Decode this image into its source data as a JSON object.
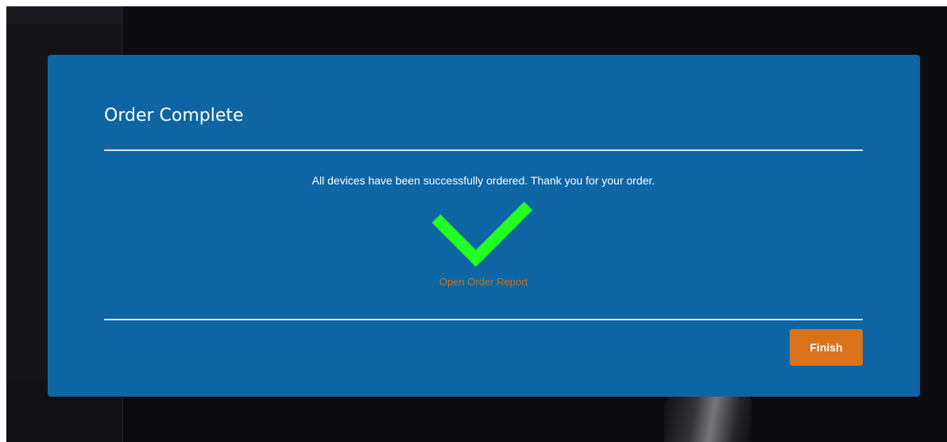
{
  "modal": {
    "title": "Order Complete",
    "message": "All devices have been successfully ordered. Thank you for your order.",
    "status_icon": "checkmark-icon",
    "report_link_label": "Open Order Report",
    "finish_label": "Finish"
  },
  "colors": {
    "modal_background": "#0e65a4",
    "checkmark": "#22ff22",
    "link": "#c7731f",
    "primary_button": "#d8731c",
    "backdrop": "#0b0b10"
  }
}
